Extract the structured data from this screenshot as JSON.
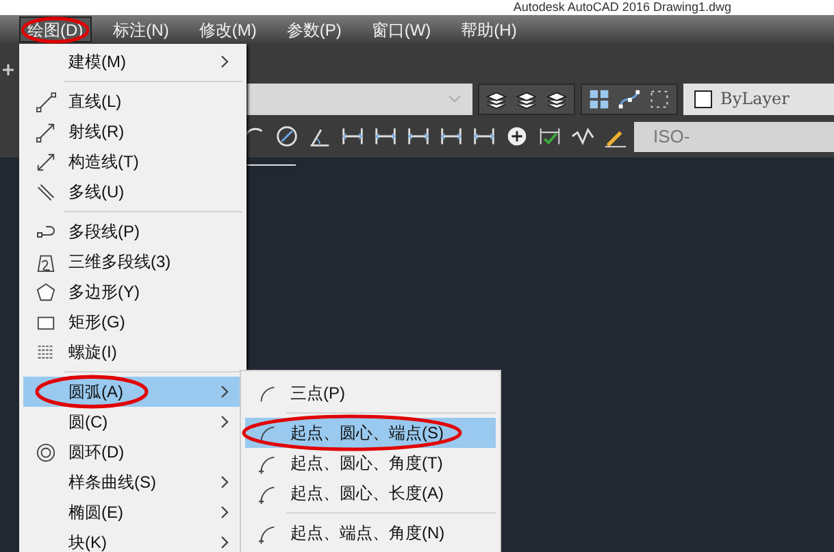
{
  "title_bar": {
    "title": "Autodesk AutoCAD 2016    Drawing1.dwg"
  },
  "menu_bar": [
    {
      "label": "绘图(D)",
      "selected": true,
      "circled": true
    },
    {
      "label": "标注(N)",
      "selected": false,
      "circled": false
    },
    {
      "label": "修改(M)",
      "selected": false,
      "circled": false
    },
    {
      "label": "参数(P)",
      "selected": false,
      "circled": false
    },
    {
      "label": "窗口(W)",
      "selected": false,
      "circled": false
    },
    {
      "label": "帮助(H)",
      "selected": false,
      "circled": false
    }
  ],
  "toolbar": {
    "color_dropdown": {
      "value": "ByLayer"
    },
    "dimstyle_field": {
      "value": "ISO-"
    }
  },
  "draw_menu": {
    "groups": [
      [
        {
          "label": "建模(M)",
          "submenu": true,
          "selected": false,
          "circled": false
        }
      ],
      [
        {
          "label": "直线(L)",
          "submenu": false,
          "selected": false,
          "circled": false
        },
        {
          "label": "射线(R)",
          "submenu": false,
          "selected": false,
          "circled": false
        },
        {
          "label": "构造线(T)",
          "submenu": false,
          "selected": false,
          "circled": false
        },
        {
          "label": "多线(U)",
          "submenu": false,
          "selected": false,
          "circled": false
        }
      ],
      [
        {
          "label": "多段线(P)",
          "submenu": false,
          "selected": false,
          "circled": false
        },
        {
          "label": "三维多段线(3)",
          "submenu": false,
          "selected": false,
          "circled": false
        },
        {
          "label": "多边形(Y)",
          "submenu": false,
          "selected": false,
          "circled": false
        },
        {
          "label": "矩形(G)",
          "submenu": false,
          "selected": false,
          "circled": false
        },
        {
          "label": "螺旋(I)",
          "submenu": false,
          "selected": false,
          "circled": false
        }
      ],
      [
        {
          "label": "圆弧(A)",
          "submenu": true,
          "selected": true,
          "circled": true
        },
        {
          "label": "圆(C)",
          "submenu": true,
          "selected": false,
          "circled": false
        },
        {
          "label": "圆环(D)",
          "submenu": false,
          "selected": false,
          "circled": false
        },
        {
          "label": "样条曲线(S)",
          "submenu": true,
          "selected": false,
          "circled": false
        },
        {
          "label": "椭圆(E)",
          "submenu": true,
          "selected": false,
          "circled": false
        },
        {
          "label": "块(K)",
          "submenu": true,
          "selected": false,
          "circled": false
        }
      ]
    ]
  },
  "arc_submenu": {
    "groups": [
      [
        {
          "label": "三点(P)",
          "selected": false,
          "circled": false
        }
      ],
      [
        {
          "label": "起点、圆心、端点(S)",
          "selected": true,
          "circled": true
        },
        {
          "label": "起点、圆心、角度(T)",
          "selected": false,
          "circled": false
        },
        {
          "label": "起点、圆心、长度(A)",
          "selected": false,
          "circled": false
        }
      ],
      [
        {
          "label": "起点、端点、角度(N)",
          "selected": false,
          "circled": false
        }
      ]
    ]
  }
}
